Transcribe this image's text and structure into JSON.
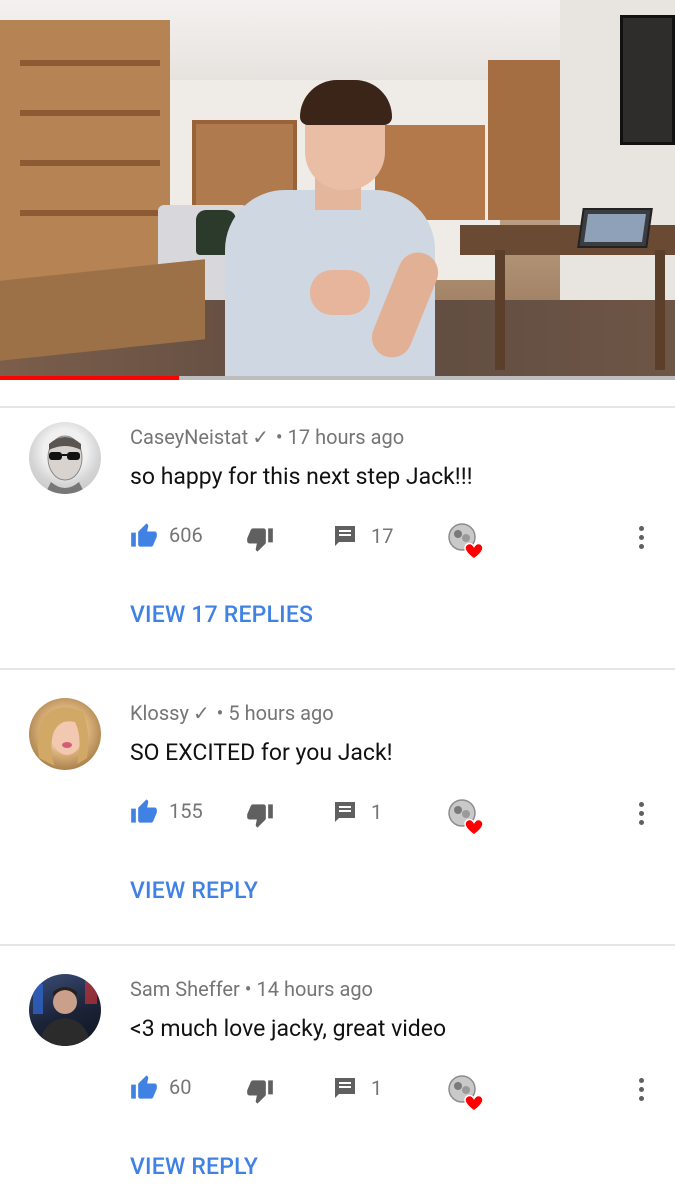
{
  "video": {
    "progress": 0.265,
    "colors": {
      "progress": "#ff0000",
      "track": "#bdbdbd"
    }
  },
  "comments": [
    {
      "author": "CaseyNeistat",
      "verified": true,
      "separator": "•",
      "time": "17 hours ago",
      "text": "so happy for this next step Jack!!!",
      "likes": "606",
      "replies_count": "17",
      "view_replies": "VIEW 17 REPLIES",
      "creator_heart": true
    },
    {
      "author": "Klossy",
      "verified": true,
      "separator": "•",
      "time": "5 hours ago",
      "text": "SO EXCITED for you Jack!",
      "likes": "155",
      "replies_count": "1",
      "view_replies": "VIEW REPLY",
      "creator_heart": true
    },
    {
      "author": "Sam Sheffer",
      "verified": false,
      "separator": "•",
      "time": "14 hours ago",
      "text": "<3 much love jacky, great video",
      "likes": "60",
      "replies_count": "1",
      "view_replies": "VIEW REPLY",
      "creator_heart": true
    }
  ],
  "icons": {
    "like": "thumbs-up-icon",
    "dislike": "thumbs-down-icon",
    "reply": "comment-icon",
    "heart": "creator-heart-icon",
    "more": "more-vert-icon"
  },
  "colors": {
    "accent": "#3f82e4",
    "like_icon": "#3f82e4",
    "heart": "#ff0000",
    "meta": "#757575"
  }
}
